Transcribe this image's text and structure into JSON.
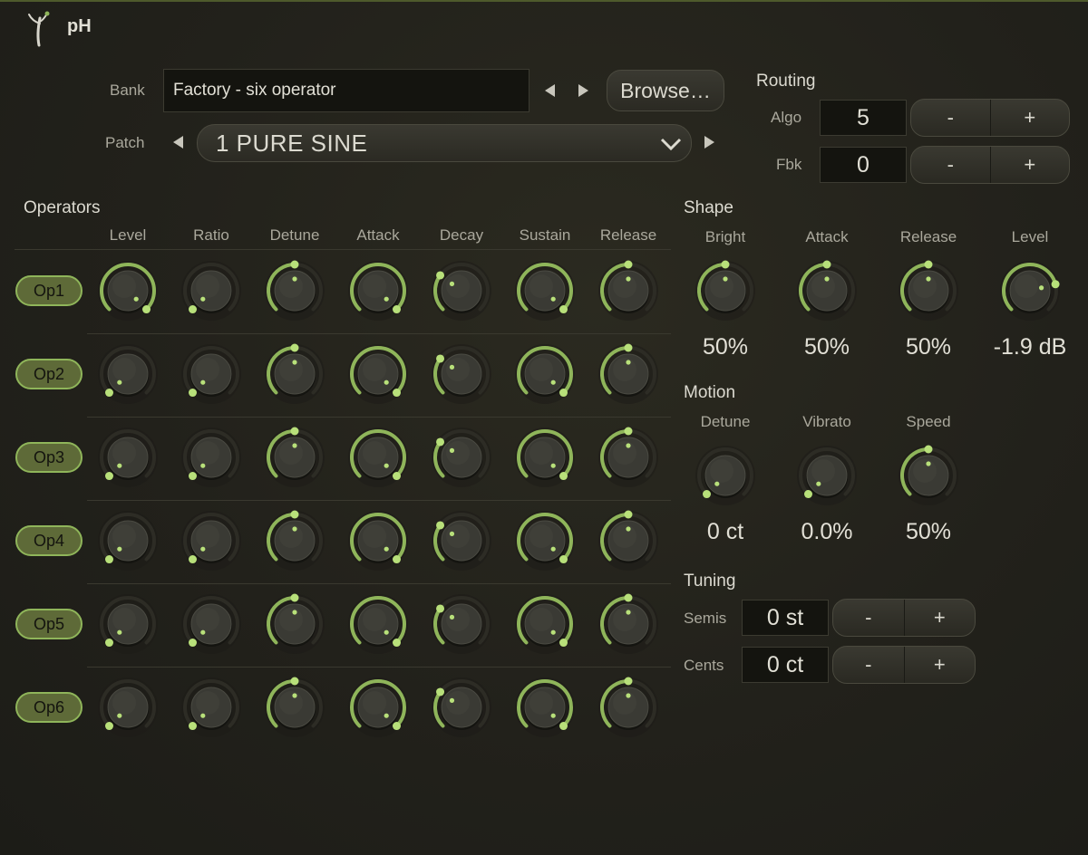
{
  "app": {
    "title": "pH"
  },
  "bank": {
    "label": "Bank",
    "value": "Factory - six operator",
    "browse_label": "Browse…"
  },
  "patch": {
    "label": "Patch",
    "value": "1 PURE SINE"
  },
  "routing": {
    "title": "Routing",
    "algo": {
      "label": "Algo",
      "value": "5",
      "minus": "-",
      "plus": "+"
    },
    "fbk": {
      "label": "Fbk",
      "value": "0",
      "minus": "-",
      "plus": "+"
    }
  },
  "operators": {
    "title": "Operators",
    "columns": [
      "Level",
      "Ratio",
      "Detune",
      "Attack",
      "Decay",
      "Sustain",
      "Release"
    ],
    "rows": [
      {
        "label": "Op1",
        "values": [
          1.0,
          0.0,
          0.5,
          1.0,
          0.3,
          1.0,
          0.5
        ]
      },
      {
        "label": "Op2",
        "values": [
          0.0,
          0.0,
          0.5,
          1.0,
          0.3,
          1.0,
          0.5
        ]
      },
      {
        "label": "Op3",
        "values": [
          0.0,
          0.0,
          0.5,
          1.0,
          0.3,
          1.0,
          0.5
        ]
      },
      {
        "label": "Op4",
        "values": [
          0.0,
          0.0,
          0.5,
          1.0,
          0.3,
          1.0,
          0.5
        ]
      },
      {
        "label": "Op5",
        "values": [
          0.0,
          0.0,
          0.5,
          1.0,
          0.3,
          1.0,
          0.5
        ]
      },
      {
        "label": "Op6",
        "values": [
          0.0,
          0.0,
          0.5,
          1.0,
          0.3,
          1.0,
          0.5
        ]
      }
    ]
  },
  "shape": {
    "title": "Shape",
    "knobs": [
      {
        "label": "Bright",
        "display": "50%",
        "value": 0.5
      },
      {
        "label": "Attack",
        "display": "50%",
        "value": 0.5
      },
      {
        "label": "Release",
        "display": "50%",
        "value": 0.5
      },
      {
        "label": "Level",
        "display": "-1.9 dB",
        "value": 0.78
      }
    ]
  },
  "motion": {
    "title": "Motion",
    "knobs": [
      {
        "label": "Detune",
        "display": "0 ct",
        "value": 0.0
      },
      {
        "label": "Vibrato",
        "display": "0.0%",
        "value": 0.0
      },
      {
        "label": "Speed",
        "display": "50%",
        "value": 0.5
      }
    ]
  },
  "tuning": {
    "title": "Tuning",
    "semis": {
      "label": "Semis",
      "value": "0 st",
      "minus": "-",
      "plus": "+"
    },
    "cents": {
      "label": "Cents",
      "value": "0 ct",
      "minus": "-",
      "plus": "+"
    }
  },
  "colors": {
    "accent": "#8fb55a",
    "accent_dim": "#6f8e45",
    "background": "#22211b",
    "field": "#14140f"
  }
}
